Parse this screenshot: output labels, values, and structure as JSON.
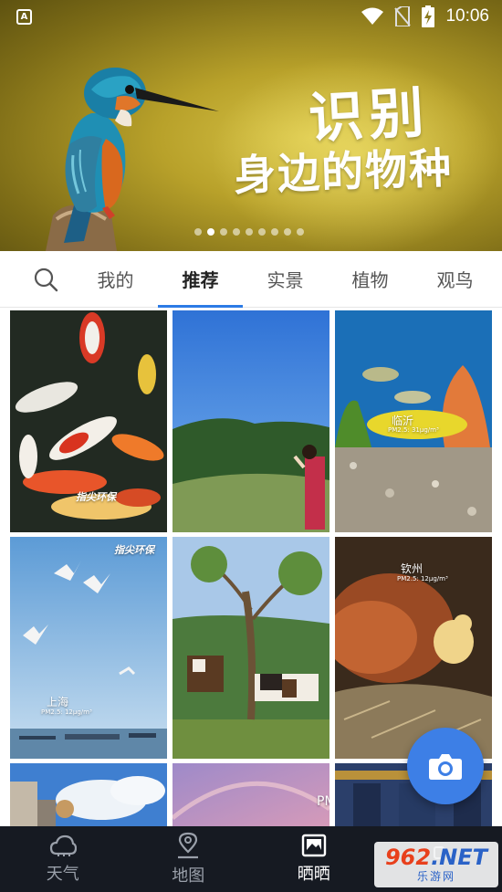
{
  "status_bar": {
    "badge": "A",
    "time": "10:06"
  },
  "banner": {
    "title": "识别",
    "subtitle": "身边的物种",
    "page_count": 9,
    "active_page": 2
  },
  "tabs": {
    "search_icon": "search-icon",
    "items": [
      {
        "label": "我的",
        "active": false
      },
      {
        "label": "推荐",
        "active": true
      },
      {
        "label": "实景",
        "active": false
      },
      {
        "label": "植物",
        "active": false
      },
      {
        "label": "观鸟",
        "active": false
      }
    ]
  },
  "feed": {
    "tiles": [
      {
        "subject": "koi fish",
        "watermark": "指尖环保"
      },
      {
        "subject": "mountain meadow with girl"
      },
      {
        "subject": "aquarium fish",
        "city": "临沂",
        "pm": "PM2.5: 31μg/m³"
      },
      {
        "subject": "seagulls over sea",
        "city": "上海",
        "pm": "PM2.5: 12μg/m³",
        "watermark": "指尖环保"
      },
      {
        "subject": "cows under tree"
      },
      {
        "subject": "hen and chick",
        "city": "钦州",
        "pm": "PM2.5: 12μg/m³"
      },
      {
        "subject": "clouds and building"
      },
      {
        "subject": "rainbow sky",
        "fragment": "PM"
      },
      {
        "subject": "gate decoration"
      }
    ]
  },
  "fab": {
    "icon": "camera-icon"
  },
  "bottom_nav": {
    "items": [
      {
        "label": "天气",
        "icon": "weather-cloud-icon",
        "active": false
      },
      {
        "label": "地图",
        "icon": "map-pin-icon",
        "active": false
      },
      {
        "label": "晒晒",
        "icon": "photo-icon",
        "active": true
      },
      {
        "label": "",
        "icon": "profile-icon",
        "active": false
      }
    ]
  },
  "watermark_logo": {
    "main": "962",
    "suffix": ".NET",
    "sub": "乐游网"
  }
}
